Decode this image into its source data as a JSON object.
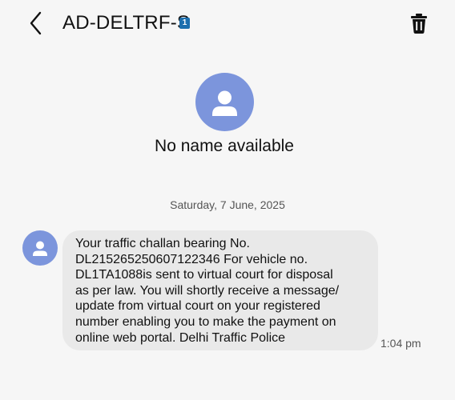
{
  "header": {
    "title": "AD-DELTRF-S",
    "sim_badge": "1"
  },
  "contact": {
    "name": "No name available"
  },
  "conversation": {
    "date": "Saturday, 7 June, 2025",
    "messages": [
      {
        "text": "Your traffic challan bearing No.\nDL215265250607122346 For vehicle no.\nDL1TA1088is sent to virtual court for disposal\nas per law. You will shortly receive a message/\nupdate from virtual court on your registered\nnumber enabling you to make the payment on\nonline web portal. Delhi Traffic Police",
        "time": "1:04 pm"
      }
    ]
  },
  "colors": {
    "avatar": "#7c95dc",
    "bubble": "#e9e9e9",
    "background": "#f6f6f6",
    "sim_badge": "#1d6fae"
  },
  "icons": {
    "back": "back-arrow-icon",
    "delete": "trash-icon",
    "avatar": "person-icon"
  }
}
